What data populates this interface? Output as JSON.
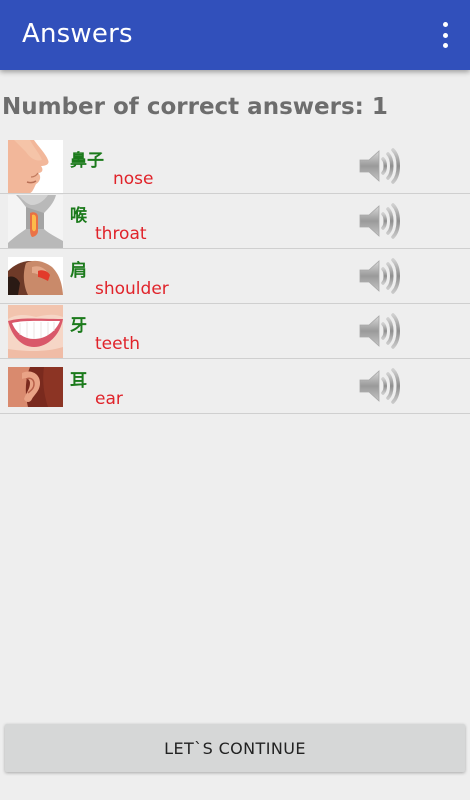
{
  "app_bar": {
    "title": "Answers",
    "menu_icon": "overflow-menu-icon",
    "color": "#3150bb"
  },
  "score_text": "Number of correct answers: 1",
  "answers": [
    {
      "chinese": "鼻子",
      "english": "nose",
      "image": "nose-photo",
      "audio_icon": "speaker-icon"
    },
    {
      "chinese": "喉",
      "english": "throat",
      "image": "throat-photo",
      "audio_icon": "speaker-icon"
    },
    {
      "chinese": "肩",
      "english": "shoulder",
      "image": "shoulder-photo",
      "audio_icon": "speaker-icon"
    },
    {
      "chinese": "牙",
      "english": "teeth",
      "image": "teeth-photo",
      "audio_icon": "speaker-icon"
    },
    {
      "chinese": "耳",
      "english": "ear",
      "image": "ear-photo",
      "audio_icon": "speaker-icon"
    }
  ],
  "continue_button": "LET`S CONTINUE",
  "colors": {
    "chinese_text": "#1b7a1b",
    "english_text": "#e0232a",
    "background": "#eeeeee"
  }
}
